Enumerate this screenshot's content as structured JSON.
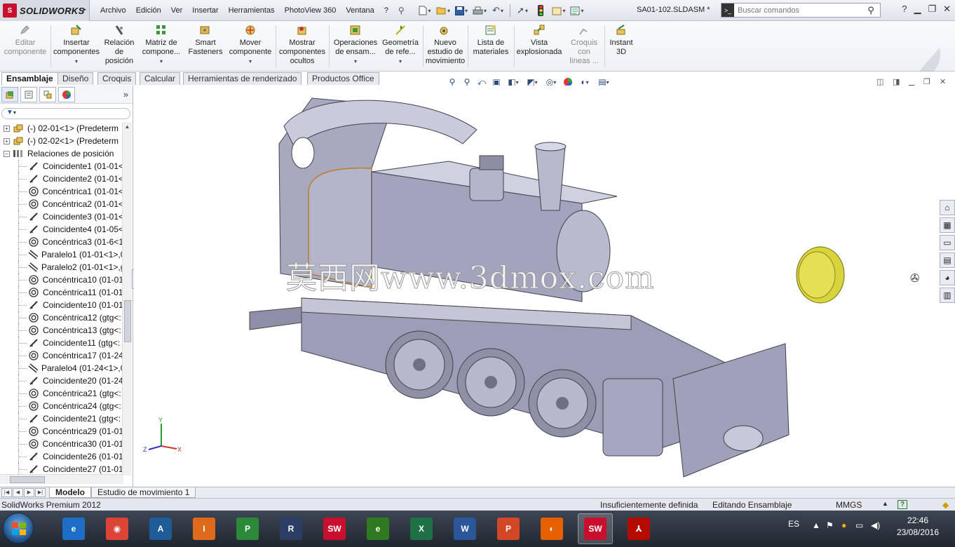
{
  "app": {
    "brand": "SOLIDWORKS",
    "document_title": "SA01-102.SLDASM *"
  },
  "menu": [
    "Archivo",
    "Edición",
    "Ver",
    "Insertar",
    "Herramientas",
    "PhotoView 360",
    "Ventana",
    "?"
  ],
  "search": {
    "placeholder": "Buscar comandos"
  },
  "ribbon": [
    {
      "label": "Editar componente",
      "lines": [
        "Editar",
        "componente"
      ],
      "icon": "edit-component-icon",
      "disabled": true
    },
    {
      "label": "Insertar componentes",
      "lines": [
        "Insertar",
        "componentes"
      ],
      "icon": "insert-components-icon",
      "dropdown": true
    },
    {
      "label": "Relación de posición",
      "lines": [
        "Relación",
        "de",
        "posición"
      ],
      "icon": "mate-icon"
    },
    {
      "label": "Matriz de compone...",
      "lines": [
        "Matriz de",
        "compone..."
      ],
      "icon": "pattern-icon",
      "dropdown": true
    },
    {
      "label": "Smart Fasteners",
      "lines": [
        "Smart",
        "Fasteners"
      ],
      "icon": "fastener-icon"
    },
    {
      "label": "Mover componente",
      "lines": [
        "Mover",
        "componente"
      ],
      "icon": "move-component-icon",
      "dropdown": true
    },
    {
      "label": "Mostrar componentes ocultos",
      "lines": [
        "Mostrar",
        "componentes",
        "ocultos"
      ],
      "icon": "show-hidden-icon"
    },
    {
      "label": "Operaciones de ensam...",
      "lines": [
        "Operaciones",
        "de ensam..."
      ],
      "icon": "assembly-features-icon",
      "dropdown": true
    },
    {
      "label": "Geometría de refe...",
      "lines": [
        "Geometría",
        "de refe..."
      ],
      "icon": "reference-geometry-icon",
      "dropdown": true
    },
    {
      "label": "Nuevo estudio de movimiento",
      "lines": [
        "Nuevo",
        "estudio de",
        "movimiento"
      ],
      "icon": "motion-study-icon"
    },
    {
      "label": "Lista de materiales",
      "lines": [
        "Lista de",
        "materiales"
      ],
      "icon": "bom-icon"
    },
    {
      "label": "Vista explosionada",
      "lines": [
        "Vista",
        "explosionada"
      ],
      "icon": "exploded-view-icon"
    },
    {
      "label": "Croquis con líneas ...",
      "lines": [
        "Croquis",
        "con",
        "líneas ..."
      ],
      "icon": "explode-line-sketch-icon",
      "disabled": true
    },
    {
      "label": "Instant 3D",
      "lines": [
        "Instant",
        "3D"
      ],
      "icon": "instant3d-icon"
    }
  ],
  "command_tabs": [
    {
      "label": "Ensamblaje",
      "active": true
    },
    {
      "label": "Diseño"
    },
    {
      "label": "Croquis"
    },
    {
      "label": "Calcular"
    },
    {
      "label": "Herramientas de renderizado"
    },
    {
      "label": "Productos Office"
    }
  ],
  "tree": {
    "filter_icon": "filter-icon",
    "nodes": [
      {
        "label": "(-) 02-01<1> (Predeterm",
        "type": "component",
        "expander": "+"
      },
      {
        "label": "(-) 02-02<1> (Predeterm",
        "type": "component",
        "expander": "+"
      },
      {
        "label": "Relaciones de posición",
        "type": "mates-folder",
        "expander": "−"
      },
      {
        "label": "Coincidente1 (01-01<",
        "type": "coincident"
      },
      {
        "label": "Coincidente2 (01-01<",
        "type": "coincident"
      },
      {
        "label": "Concéntrica1 (01-01<",
        "type": "concentric"
      },
      {
        "label": "Concéntrica2 (01-01<",
        "type": "concentric"
      },
      {
        "label": "Coincidente3 (01-01<",
        "type": "coincident"
      },
      {
        "label": "Coincidente4 (01-05<",
        "type": "coincident"
      },
      {
        "label": "Concéntrica3 (01-6<1",
        "type": "concentric"
      },
      {
        "label": "Paralelo1 (01-01<1>,0",
        "type": "parallel"
      },
      {
        "label": "Paralelo2 (01-01<1>,g",
        "type": "parallel"
      },
      {
        "label": "Concéntrica10 (01-01",
        "type": "concentric"
      },
      {
        "label": "Concéntrica11 (01-01",
        "type": "concentric"
      },
      {
        "label": "Coincidente10 (01-01",
        "type": "coincident"
      },
      {
        "label": "Concéntrica12 (gtg<:",
        "type": "concentric"
      },
      {
        "label": "Concéntrica13 (gtg<:",
        "type": "concentric"
      },
      {
        "label": "Coincidente11 (gtg<:",
        "type": "coincident"
      },
      {
        "label": "Concéntrica17 (01-24",
        "type": "concentric"
      },
      {
        "label": "Paralelo4 (01-24<1>,0",
        "type": "parallel"
      },
      {
        "label": "Coincidente20 (01-24",
        "type": "coincident"
      },
      {
        "label": "Concéntrica21 (gtg<:",
        "type": "concentric"
      },
      {
        "label": "Concéntrica24 (gtg<:",
        "type": "concentric"
      },
      {
        "label": "Coincidente21 (gtg<:",
        "type": "coincident"
      },
      {
        "label": "Concéntrica29 (01-01",
        "type": "concentric"
      },
      {
        "label": "Concéntrica30 (01-01",
        "type": "concentric"
      },
      {
        "label": "Coincidente26 (01-01",
        "type": "coincident"
      },
      {
        "label": "Coincidente27 (01-01",
        "type": "coincident"
      }
    ]
  },
  "graphics": {
    "watermark": "莫西网www.3dmox.com",
    "triad": {
      "x": "X",
      "y": "Y",
      "z": "Z"
    },
    "model": "locomotive-assembly"
  },
  "bottom_tabs": [
    {
      "label": "Modelo",
      "active": true
    },
    {
      "label": "Estudio de movimiento 1"
    }
  ],
  "status": {
    "product": "SolidWorks Premium 2012",
    "definition": "Insuficientemente definida",
    "mode": "Editando Ensamblaje",
    "units": "MMGS"
  },
  "taskbar": {
    "apps": [
      {
        "name": "ie-icon"
      },
      {
        "name": "chrome-icon"
      },
      {
        "name": "autocad-p&id-icon"
      },
      {
        "name": "inventor-pro-icon"
      },
      {
        "name": "project-icon"
      },
      {
        "name": "revit-icon"
      },
      {
        "name": "solidworks-icon"
      },
      {
        "name": "e-drawings-icon"
      },
      {
        "name": "excel-icon"
      },
      {
        "name": "word-icon"
      },
      {
        "name": "powerpoint-icon"
      },
      {
        "name": "firefox-icon"
      },
      {
        "name": "solidworks-active-icon",
        "active": true
      },
      {
        "name": "acrobat-icon"
      }
    ],
    "language": "ES",
    "time": "22:46",
    "date": "23/08/2016"
  },
  "colors": {
    "accent_blue": "#1f4e87",
    "solidworks_red": "#c8102e",
    "model_metal": "#a9abc0",
    "yellow_part": "#d9d43a"
  }
}
